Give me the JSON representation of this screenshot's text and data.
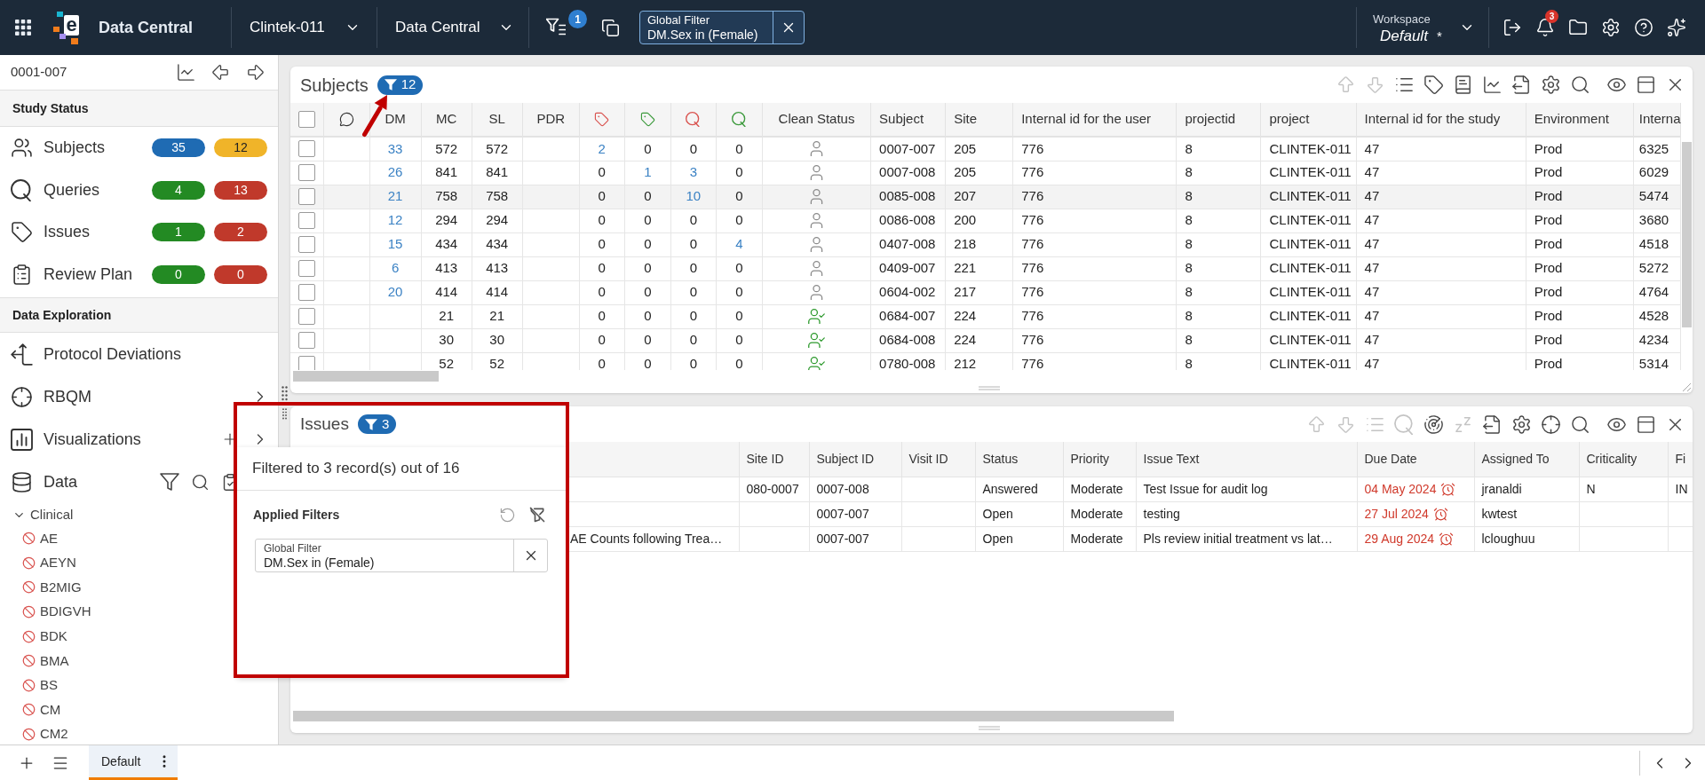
{
  "top_bar": {
    "logo_text": "e",
    "app_name": "Data Central",
    "study_dropdown": "Clintek-011",
    "module_dropdown": "Data Central",
    "filter_badge": "1",
    "global_filter": {
      "label": "Global Filter",
      "value": "DM.Sex in (Female)"
    },
    "workspace": {
      "label": "Workspace",
      "name": "Default",
      "unsaved_mark": "*"
    },
    "notification_badge": "3"
  },
  "sidebar": {
    "subject": "0001-007",
    "study_status": {
      "title": "Study Status",
      "items": [
        {
          "label": "Subjects",
          "counts": [
            {
              "text": "35",
              "color": "#1f6bb3"
            },
            {
              "text": "12",
              "color": "#f0b429"
            }
          ]
        },
        {
          "label": "Queries",
          "counts": [
            {
              "text": "4",
              "color": "#238a23"
            },
            {
              "text": "13",
              "color": "#c0392b"
            }
          ]
        },
        {
          "label": "Issues",
          "counts": [
            {
              "text": "1",
              "color": "#238a23"
            },
            {
              "text": "2",
              "color": "#c0392b"
            }
          ]
        },
        {
          "label": "Review Plan",
          "counts": [
            {
              "text": "0",
              "color": "#238a23"
            },
            {
              "text": "0",
              "color": "#c0392b"
            }
          ]
        }
      ]
    },
    "data_exploration": {
      "title": "Data Exploration",
      "items": [
        {
          "label": "Protocol Deviations",
          "kind": "link"
        },
        {
          "label": "RBQM",
          "kind": "submenu"
        },
        {
          "label": "Visualizations",
          "kind": "addable"
        },
        {
          "label": "Data",
          "kind": "data"
        }
      ]
    },
    "tree": [
      {
        "label": "Clinical",
        "expanded": true,
        "children": [
          {
            "label": "AE",
            "blocked": true
          },
          {
            "label": "AEYN",
            "blocked": true
          },
          {
            "label": "B2MIG",
            "blocked": true
          },
          {
            "label": "BDIGVH",
            "blocked": true
          },
          {
            "label": "BDK",
            "blocked": true
          },
          {
            "label": "BMA",
            "blocked": true
          },
          {
            "label": "BS",
            "blocked": true
          },
          {
            "label": "CM",
            "blocked": true
          },
          {
            "label": "CM2",
            "blocked": true
          }
        ]
      }
    ]
  },
  "subjects_panel": {
    "title": "Subjects",
    "filter_badge": "12",
    "toolbar": [
      {
        "kind": "move_up",
        "disabled": true
      },
      {
        "kind": "move_down",
        "disabled": true
      },
      {
        "kind": "list",
        "disabled": false
      },
      {
        "kind": "tag",
        "disabled": false
      },
      {
        "kind": "book",
        "disabled": false
      },
      {
        "kind": "chart",
        "disabled": false
      },
      {
        "kind": "export",
        "disabled": false
      },
      {
        "kind": "settings",
        "disabled": false
      },
      {
        "kind": "search",
        "disabled": false
      },
      {
        "kind": "view",
        "disabled": false
      },
      {
        "kind": "layout",
        "disabled": false
      },
      {
        "kind": "close",
        "disabled": false
      }
    ],
    "table": {
      "select_all_checked": false,
      "columns": [
        {
          "kind": "select"
        },
        {
          "kind": "comment"
        },
        {
          "kind": "number",
          "label": "DM"
        },
        {
          "kind": "number",
          "label": "MC"
        },
        {
          "kind": "number",
          "label": "SL"
        },
        {
          "kind": "number",
          "label": "PDR"
        },
        {
          "kind": "tag",
          "color": "#d9534f"
        },
        {
          "kind": "tag",
          "color": "#3c9a3c"
        },
        {
          "kind": "query",
          "color": "#d9534f"
        },
        {
          "kind": "query",
          "color": "#3c9a3c"
        },
        {
          "kind": "status",
          "label": "Clean Status"
        },
        {
          "kind": "text",
          "label": "Subject"
        },
        {
          "kind": "text",
          "label": "Site"
        },
        {
          "kind": "text",
          "label": "Internal id for the user"
        },
        {
          "kind": "text",
          "label": "projectid"
        },
        {
          "kind": "text",
          "label": "project"
        },
        {
          "kind": "text",
          "label": "Internal id for the study"
        },
        {
          "kind": "text",
          "label": "Environment"
        },
        {
          "kind": "text",
          "label": "Interna"
        }
      ],
      "rows": [
        {
          "checked": false,
          "hovered": false,
          "clean": false,
          "cells": [
            null,
            null,
            {
              "text": "33",
              "link": true
            },
            "572",
            "572",
            null,
            {
              "text": "2",
              "link": true
            },
            "0",
            "0",
            "0",
            null,
            "0007-007",
            "205",
            "776",
            "8",
            "CLINTEK-011",
            "47",
            "Prod",
            "6325"
          ]
        },
        {
          "checked": false,
          "hovered": false,
          "clean": false,
          "cells": [
            null,
            null,
            {
              "text": "26",
              "link": true
            },
            "841",
            "841",
            null,
            "0",
            {
              "text": "1",
              "link": true
            },
            {
              "text": "3",
              "link": true
            },
            "0",
            null,
            "0007-008",
            "205",
            "776",
            "8",
            "CLINTEK-011",
            "47",
            "Prod",
            "6029"
          ]
        },
        {
          "checked": false,
          "hovered": true,
          "clean": false,
          "cells": [
            null,
            null,
            {
              "text": "21",
              "link": true
            },
            "758",
            "758",
            null,
            "0",
            "0",
            {
              "text": "10",
              "link": true
            },
            "0",
            null,
            "0085-008",
            "207",
            "776",
            "8",
            "CLINTEK-011",
            "47",
            "Prod",
            "5474"
          ]
        },
        {
          "checked": false,
          "hovered": false,
          "clean": false,
          "cells": [
            null,
            null,
            {
              "text": "12",
              "link": true
            },
            "294",
            "294",
            null,
            "0",
            "0",
            "0",
            "0",
            null,
            "0086-008",
            "200",
            "776",
            "8",
            "CLINTEK-011",
            "47",
            "Prod",
            "3680"
          ]
        },
        {
          "checked": false,
          "hovered": false,
          "clean": false,
          "cells": [
            null,
            null,
            {
              "text": "15",
              "link": true
            },
            "434",
            "434",
            null,
            "0",
            "0",
            "0",
            {
              "text": "4",
              "link": true
            },
            null,
            "0407-008",
            "218",
            "776",
            "8",
            "CLINTEK-011",
            "47",
            "Prod",
            "4518"
          ]
        },
        {
          "checked": false,
          "hovered": false,
          "clean": false,
          "cells": [
            null,
            null,
            {
              "text": "6",
              "link": true
            },
            "413",
            "413",
            null,
            "0",
            "0",
            "0",
            "0",
            null,
            "0409-007",
            "221",
            "776",
            "8",
            "CLINTEK-011",
            "47",
            "Prod",
            "5272"
          ]
        },
        {
          "checked": false,
          "hovered": false,
          "clean": false,
          "cells": [
            null,
            null,
            {
              "text": "20",
              "link": true
            },
            "414",
            "414",
            null,
            "0",
            "0",
            "0",
            "0",
            null,
            "0604-002",
            "217",
            "776",
            "8",
            "CLINTEK-011",
            "47",
            "Prod",
            "4764"
          ]
        },
        {
          "checked": false,
          "hovered": false,
          "clean": true,
          "cells": [
            null,
            null,
            null,
            "21",
            "21",
            null,
            "0",
            "0",
            "0",
            "0",
            null,
            "0684-007",
            "224",
            "776",
            "8",
            "CLINTEK-011",
            "47",
            "Prod",
            "4528"
          ]
        },
        {
          "checked": false,
          "hovered": false,
          "clean": true,
          "cells": [
            null,
            null,
            null,
            "30",
            "30",
            null,
            "0",
            "0",
            "0",
            "0",
            null,
            "0684-008",
            "224",
            "776",
            "8",
            "CLINTEK-011",
            "47",
            "Prod",
            "4234"
          ]
        },
        {
          "checked": false,
          "hovered": false,
          "clean": true,
          "cells": [
            null,
            null,
            null,
            "52",
            "52",
            null,
            "0",
            "0",
            "0",
            "0",
            null,
            "0780-008",
            "212",
            "776",
            "8",
            "CLINTEK-011",
            "47",
            "Prod",
            "5314"
          ]
        }
      ]
    }
  },
  "issues_panel": {
    "title": "Issues",
    "filter_badge": "3",
    "toolbar": [
      {
        "kind": "move_up",
        "disabled": true
      },
      {
        "kind": "move_down",
        "disabled": true
      },
      {
        "kind": "list",
        "disabled": true
      },
      {
        "kind": "query",
        "disabled": true
      },
      {
        "kind": "radar",
        "disabled": false
      },
      {
        "kind": "snooze",
        "disabled": true
      },
      {
        "kind": "export",
        "disabled": false
      },
      {
        "kind": "settings",
        "disabled": false
      },
      {
        "kind": "target",
        "disabled": false
      },
      {
        "kind": "search",
        "disabled": false
      },
      {
        "kind": "view",
        "disabled": false
      },
      {
        "kind": "layout",
        "disabled": false
      },
      {
        "kind": "close",
        "disabled": false
      }
    ],
    "table": {
      "columns": [
        {
          "kind": "text",
          "label": "Site ID"
        },
        {
          "kind": "text",
          "label": "Subject ID"
        },
        {
          "kind": "text",
          "label": "Visit ID"
        },
        {
          "kind": "text",
          "label": "Status"
        },
        {
          "kind": "text",
          "label": "Priority"
        },
        {
          "kind": "text",
          "label": "Issue Text"
        },
        {
          "kind": "due",
          "label": "Due Date"
        },
        {
          "kind": "text",
          "label": "Assigned To"
        },
        {
          "kind": "text",
          "label": "Criticality"
        },
        {
          "kind": "text",
          "label": "Fi"
        }
      ],
      "rows": [
        {
          "overdue": true,
          "cells": [
            "080-0007",
            "0007-008",
            null,
            "Answered",
            "Moderate",
            "Test Issue for audit log",
            "04 May 2024",
            "jranaldi",
            "N",
            "IN"
          ]
        },
        {
          "overdue": true,
          "cells": [
            null,
            "0007-007",
            null,
            "Open",
            "Moderate",
            "testing",
            "27 Jul 2024",
            "kwtest",
            null,
            null
          ]
        },
        {
          "column_1": "AE Counts following Trea…",
          "overdue": true,
          "cells": [
            null,
            "0007-007",
            null,
            "Open",
            "Moderate",
            "Pls review initial treatment vs lat…",
            "29 Aug 2024",
            "lcloughuu",
            null,
            null
          ]
        }
      ]
    }
  },
  "filter_popover": {
    "summary": "Filtered to 3 record(s) out of 16",
    "title": "Applied Filters",
    "filters": [
      {
        "label": "Global Filter",
        "value": "DM.Sex in (Female)"
      }
    ]
  },
  "bottom_bar": {
    "tabs": [
      {
        "label": "Default",
        "selected": true
      }
    ]
  }
}
